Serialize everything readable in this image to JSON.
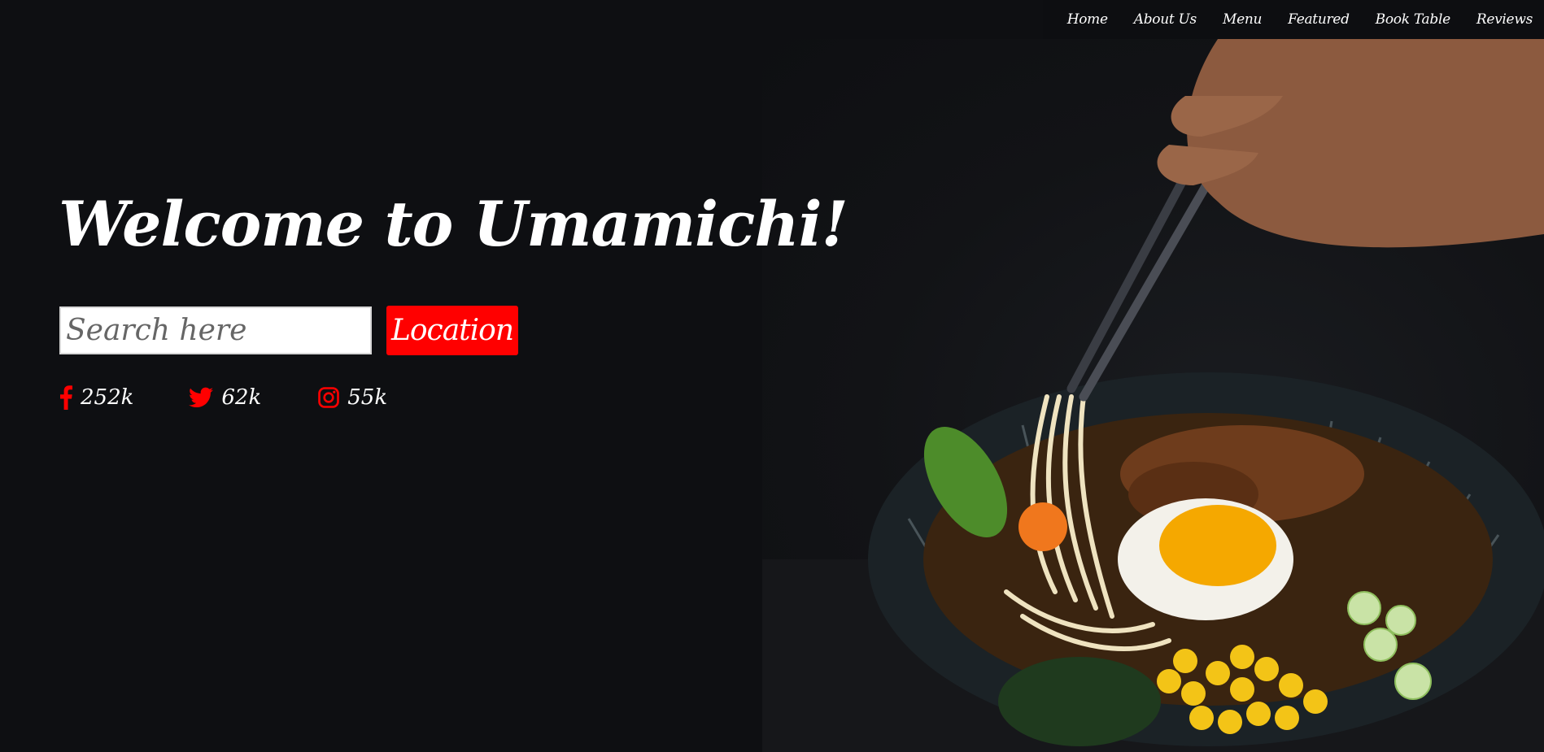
{
  "nav": {
    "items": [
      {
        "label": "Home"
      },
      {
        "label": "About Us"
      },
      {
        "label": "Menu"
      },
      {
        "label": "Featured"
      },
      {
        "label": "Book Table"
      },
      {
        "label": "Reviews"
      }
    ]
  },
  "hero": {
    "title": "Welcome to Umamichi!",
    "search_placeholder": "Search here",
    "location_label": "Location"
  },
  "socials": [
    {
      "network": "facebook",
      "icon": "facebook-icon",
      "count": "252k"
    },
    {
      "network": "twitter",
      "icon": "twitter-icon",
      "count": "62k"
    },
    {
      "network": "instagram",
      "icon": "instagram-icon",
      "count": "55k"
    }
  ],
  "colors": {
    "background": "#0e0f12",
    "accent": "#ff0000",
    "text": "#ffffff"
  }
}
